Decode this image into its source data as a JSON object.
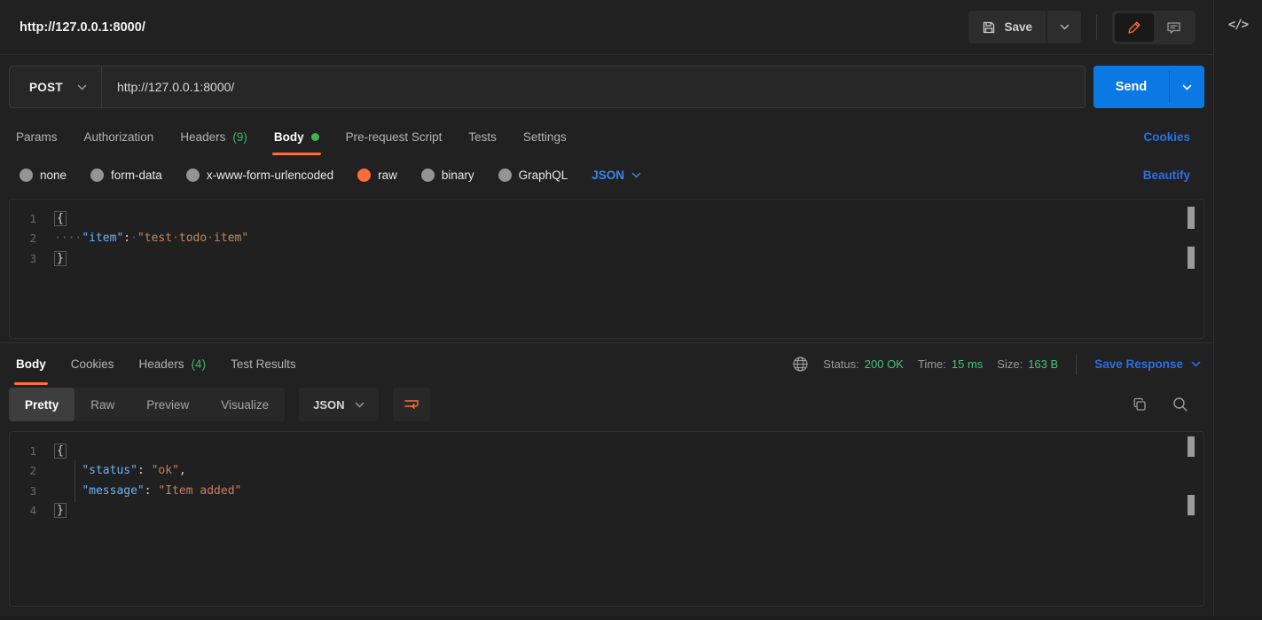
{
  "topbar": {
    "title": "http://127.0.0.1:8000/",
    "save_label": "Save",
    "code_icon": "</>"
  },
  "request_bar": {
    "method": "POST",
    "url": "http://127.0.0.1:8000/",
    "send_label": "Send"
  },
  "request_tabs": {
    "params": "Params",
    "authorization": "Authorization",
    "headers": "Headers",
    "headers_count": "(9)",
    "body": "Body",
    "pre_request": "Pre-request Script",
    "tests": "Tests",
    "settings": "Settings",
    "cookies_link": "Cookies"
  },
  "body_type_bar": {
    "none": "none",
    "form_data": "form-data",
    "x_www_form_urlencoded": "x-www-form-urlencoded",
    "raw": "raw",
    "binary": "binary",
    "graphql": "GraphQL",
    "selected": "raw",
    "format": "JSON",
    "beautify_link": "Beautify"
  },
  "request_editor": {
    "ln1": "1",
    "ln2": "2",
    "ln3": "3",
    "open_brace": "{",
    "indent_dots": "····",
    "key": "\"item\"",
    "colon": ":",
    "sep_dot": "·",
    "value_part1": "\"test",
    "value_dot1": "·",
    "value_part2": "todo",
    "value_dot2": "·",
    "value_part3": "item\"",
    "close_brace": "}",
    "json_text": "{ \"item\": \"test todo item\" }"
  },
  "response_meta": {
    "body_tab": "Body",
    "cookies_tab": "Cookies",
    "headers_tab": "Headers",
    "headers_count": "(4)",
    "test_results_tab": "Test Results",
    "status_label": "Status:",
    "status_value": "200 OK",
    "time_label": "Time:",
    "time_value": "15 ms",
    "size_label": "Size:",
    "size_value": "163 B",
    "save_response_label": "Save Response"
  },
  "response_toolbar": {
    "pretty": "Pretty",
    "raw": "Raw",
    "preview": "Preview",
    "visualize": "Visualize",
    "selected_view": "Pretty",
    "format": "JSON"
  },
  "response_editor": {
    "ln1": "1",
    "ln2": "2",
    "ln3": "3",
    "ln4": "4",
    "open_brace": "{",
    "l2_indent": "    ",
    "l2_key": "\"status\"",
    "l2_colon": ": ",
    "l2_value": "\"ok\"",
    "l2_comma": ",",
    "l3_indent": "    ",
    "l3_key": "\"message\"",
    "l3_colon": ": ",
    "l3_value": "\"Item added\"",
    "close_brace": "}",
    "json_text": "{ \"status\": \"ok\", \"message\": \"Item added\" }"
  },
  "colors": {
    "accent_orange": "#ff6c37",
    "link_blue": "#2c6fe4",
    "send_blue": "#0b79e3",
    "status_green": "#45c283",
    "count_green": "#3eb56d",
    "json_key_blue": "#6cb1f5",
    "json_string_request": "#bf8a5e",
    "json_string_response": "#ce7b64"
  }
}
